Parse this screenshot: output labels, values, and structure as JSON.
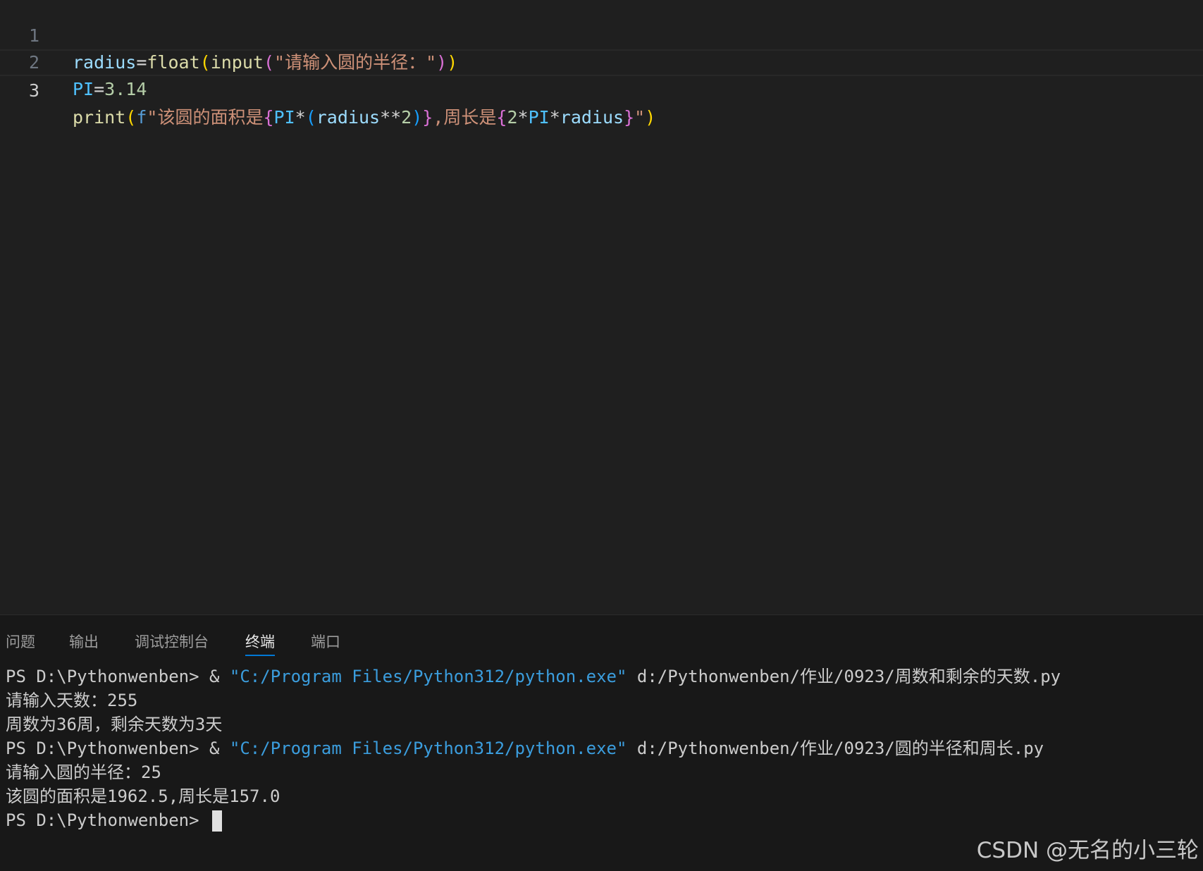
{
  "editor": {
    "lines": [
      {
        "number": "1",
        "tokens": [
          {
            "text": "radius",
            "cls": "var"
          },
          {
            "text": "=",
            "cls": "op"
          },
          {
            "text": "float",
            "cls": "fn"
          },
          {
            "text": "(",
            "cls": "b1"
          },
          {
            "text": "input",
            "cls": "fn"
          },
          {
            "text": "(",
            "cls": "b2"
          },
          {
            "text": "\"请输入圆的半径：\"",
            "cls": "str"
          },
          {
            "text": ")",
            "cls": "b2"
          },
          {
            "text": ")",
            "cls": "b1"
          }
        ]
      },
      {
        "number": "2",
        "tokens": [
          {
            "text": "PI",
            "cls": "const"
          },
          {
            "text": "=",
            "cls": "op"
          },
          {
            "text": "3.14",
            "cls": "num"
          }
        ]
      },
      {
        "number": "3",
        "tokens": [
          {
            "text": "print",
            "cls": "fn"
          },
          {
            "text": "(",
            "cls": "b1"
          },
          {
            "text": "f",
            "cls": "kw"
          },
          {
            "text": "\"该圆的面积是",
            "cls": "str"
          },
          {
            "text": "{",
            "cls": "b2"
          },
          {
            "text": "PI",
            "cls": "const"
          },
          {
            "text": "*",
            "cls": "op"
          },
          {
            "text": "(",
            "cls": "b3"
          },
          {
            "text": "radius",
            "cls": "var"
          },
          {
            "text": "**",
            "cls": "op"
          },
          {
            "text": "2",
            "cls": "num"
          },
          {
            "text": ")",
            "cls": "b3"
          },
          {
            "text": "}",
            "cls": "b2"
          },
          {
            "text": ",周长是",
            "cls": "str"
          },
          {
            "text": "{",
            "cls": "b2"
          },
          {
            "text": "2",
            "cls": "num"
          },
          {
            "text": "*",
            "cls": "op"
          },
          {
            "text": "PI",
            "cls": "const"
          },
          {
            "text": "*",
            "cls": "op"
          },
          {
            "text": "radius",
            "cls": "var"
          },
          {
            "text": "}",
            "cls": "b2"
          },
          {
            "text": "\"",
            "cls": "str"
          },
          {
            "text": ")",
            "cls": "b1"
          }
        ]
      }
    ]
  },
  "panel": {
    "tabs": [
      {
        "label": "问题",
        "active": false
      },
      {
        "label": "输出",
        "active": false
      },
      {
        "label": "调试控制台",
        "active": false
      },
      {
        "label": "终端",
        "active": true
      },
      {
        "label": "端口",
        "active": false
      }
    ],
    "terminal": {
      "run1": {
        "prompt": "PS D:\\Pythonwenben> & ",
        "exe": "\"C:/Program Files/Python312/python.exe\"",
        "script": " d:/Pythonwenben/作业/0923/周数和剩余的天数.py"
      },
      "out1": "请输入天数：255",
      "out2": "周数为36周，剩余天数为3天",
      "run2": {
        "prompt": "PS D:\\Pythonwenben> & ",
        "exe": "\"C:/Program Files/Python312/python.exe\"",
        "script": " d:/Pythonwenben/作业/0923/圆的半径和周长.py"
      },
      "out3": "请输入圆的半径：25",
      "out4": "该圆的面积是1962.5,周长是157.0",
      "last_prompt": "PS D:\\Pythonwenben> "
    }
  },
  "watermark": "CSDN @无名的小三轮"
}
